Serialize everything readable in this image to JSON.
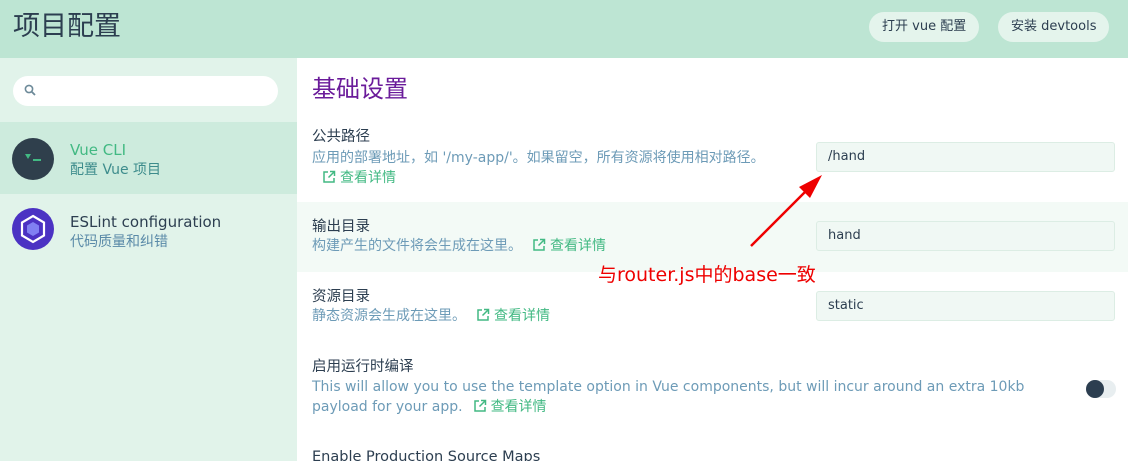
{
  "header": {
    "title": "项目配置",
    "buttons": {
      "open_vue_config": "打开 vue 配置",
      "install_devtools": "安装 devtools"
    }
  },
  "sidebar": {
    "search": {
      "placeholder": "",
      "value": ""
    },
    "items": [
      {
        "name": "Vue CLI",
        "desc": "配置 Vue 项目",
        "selected": true,
        "icon": "vue-cli-icon"
      },
      {
        "name": "ESLint configuration",
        "desc": "代码质量和纠错",
        "selected": false,
        "icon": "eslint-icon"
      }
    ]
  },
  "main": {
    "section_title": "基础设置",
    "more_label": "查看详情",
    "fields": {
      "public_path": {
        "label": "公共路径",
        "desc": "应用的部署地址，如 '/my-app/'。如果留空，所有资源将使用相对路径。",
        "value": "/hand"
      },
      "output_dir": {
        "label": "输出目录",
        "desc": "构建产生的文件将会生成在这里。",
        "value": "hand"
      },
      "assets_dir": {
        "label": "资源目录",
        "desc": "静态资源会生成在这里。",
        "value": "static"
      },
      "runtime_compiler": {
        "label": "启用运行时编译",
        "desc": "This will allow you to use the template option in Vue components, but will incur around an extra 10kb payload for your app.",
        "enabled": false
      },
      "source_maps": {
        "label": "Enable Production Source Maps"
      }
    }
  },
  "annotation": {
    "text": "与router.js中的base一致"
  },
  "colors": {
    "header_bg": "#bde5d3",
    "sidebar_bg": "#e1f3ea",
    "accent_green": "#42b983",
    "section_purple": "#6a1b9a",
    "annotation_red": "#ee0000"
  }
}
